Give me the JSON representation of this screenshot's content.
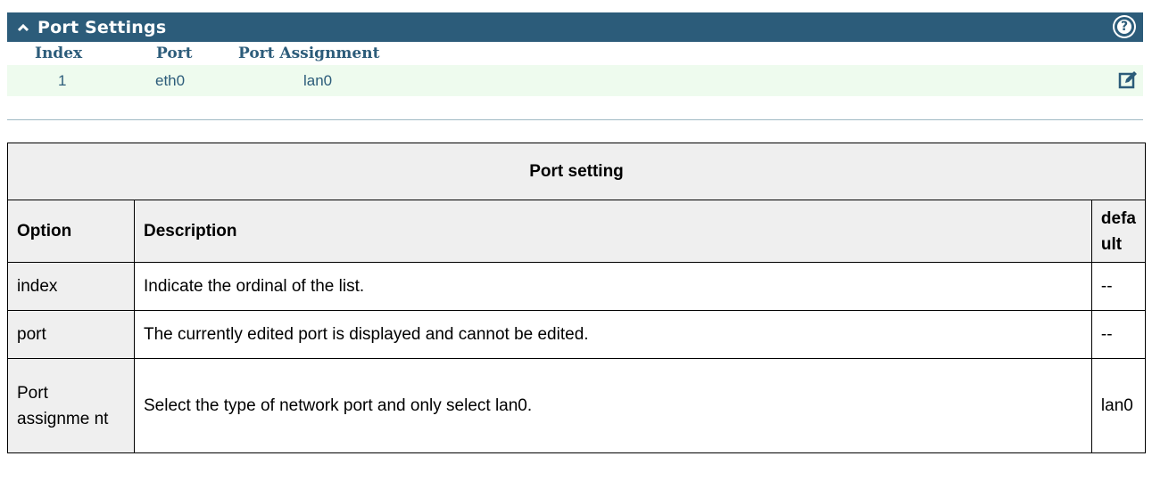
{
  "panel": {
    "title": "Port Settings",
    "columns": [
      "Index",
      "Port",
      "Port Assignment"
    ],
    "row": {
      "index": "1",
      "port": "eth0",
      "assignment": "lan0"
    },
    "icons": {
      "collapse": "chevron-up-icon",
      "help": "help-icon",
      "edit": "edit-icon"
    },
    "colors": {
      "header_bg": "#2c5c7a",
      "row_bg": "#eefbee",
      "text": "#2c5c7a"
    }
  },
  "table": {
    "title": "Port setting",
    "headers": {
      "option": "Option",
      "description": "Description",
      "default": "defa ult"
    },
    "rows": [
      {
        "option": "index",
        "description": " Indicate the ordinal of the list.",
        "default": "--"
      },
      {
        "option": "port",
        "description": "The currently edited port is displayed and cannot be edited.",
        "default": "--"
      },
      {
        "option": "Port assignme nt",
        "description": "Select the type of network port and only select lan0.",
        "default": "lan0"
      }
    ]
  }
}
